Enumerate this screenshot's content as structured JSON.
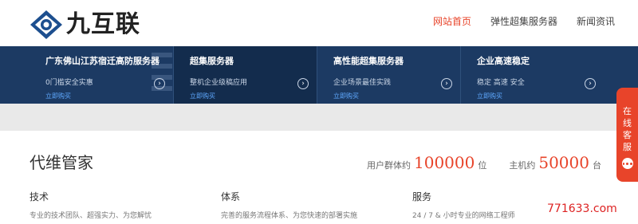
{
  "header": {
    "logo_text": "九互联",
    "nav": [
      {
        "label": "网站首页",
        "active": true
      },
      {
        "label": "弹性超集服务器",
        "active": false
      },
      {
        "label": "新闻资讯",
        "active": false
      }
    ]
  },
  "banner": {
    "panels": [
      {
        "title": "广东佛山江苏宿迁高防服务器",
        "desc": "0门槛安全实惠",
        "link": "立即购买",
        "arrow_icon": "chevron-right-icon"
      },
      {
        "title": "超集服务器",
        "desc": "整机企业级稿应用",
        "link": "立即购买",
        "arrow_icon": "chevron-right-icon"
      },
      {
        "title": "高性能超集服务器",
        "desc": "企业场景最佳实践",
        "link": "立即购买",
        "arrow_icon": "chevron-right-icon"
      },
      {
        "title": "企业高速稳定",
        "desc": "稳定 高速 安全",
        "link": "立即购买",
        "arrow_icon": "chevron-right-icon"
      }
    ]
  },
  "section": {
    "title": "代维管家",
    "stats": [
      {
        "label": "用户群体约",
        "value": "100000",
        "unit": "位"
      },
      {
        "label": "主机约",
        "value": "50000",
        "unit": "台"
      }
    ],
    "features": [
      {
        "title": "技术",
        "desc": "专业的技术团队、超强实力、为您解忧"
      },
      {
        "title": "体系",
        "desc": "完善的服务流程体系、为您快速的部署实施"
      },
      {
        "title": "服务",
        "desc": "24 / 7 & 小时专业的网络工程师"
      }
    ]
  },
  "float_tab": {
    "label": "在线客服",
    "icon": "chat-icon"
  },
  "watermark": "771633.com",
  "colors": {
    "accent": "#e8442a",
    "banner_bg": "#1c3a63",
    "banner_dark": "#132c4d",
    "link_blue": "#5fa9ff"
  }
}
